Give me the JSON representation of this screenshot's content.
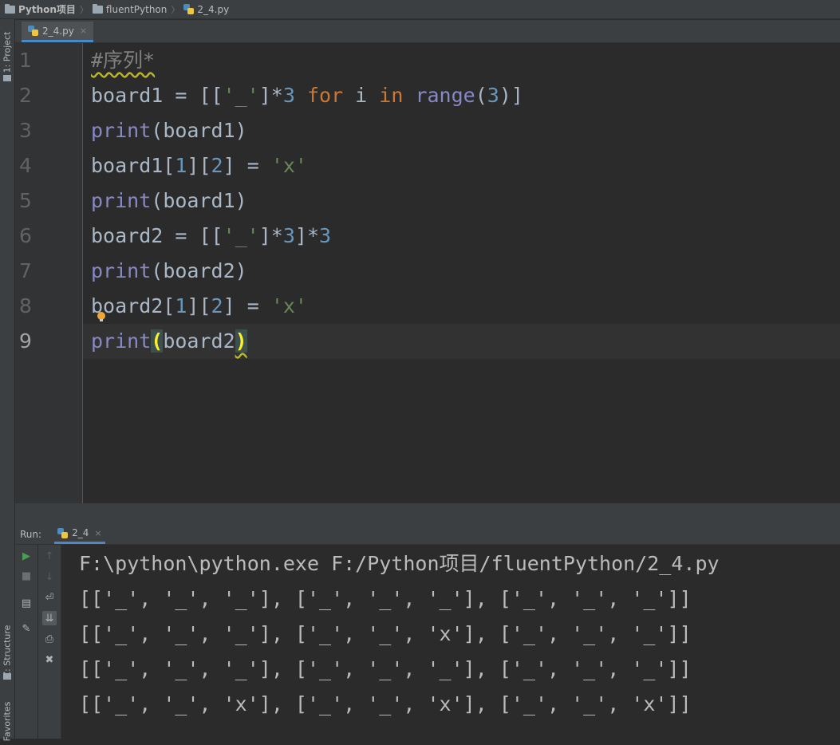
{
  "breadcrumb": {
    "project": "Python项目",
    "folder": "fluentPython",
    "file": "2_4.py"
  },
  "left_strip": {
    "project_tab": "1: Project",
    "structure_tab": "Z: Structure",
    "favorites_tab": "Favorites"
  },
  "editor_tab": {
    "label": "2_4.py",
    "close": "×"
  },
  "line_numbers": [
    "1",
    "2",
    "3",
    "4",
    "5",
    "6",
    "7",
    "8",
    "9"
  ],
  "code": {
    "l1": "#序列*",
    "l2": {
      "a": "board1 = [[",
      "b": "'_'",
      "c": "]*",
      "d": "3",
      "e": " ",
      "f": "for",
      "g": " i ",
      "h": "in",
      "i": " ",
      "j": "range",
      "k": "(",
      "l": "3",
      "m": ")]"
    },
    "l3": {
      "a": "print",
      "b": "(board1)"
    },
    "l4": {
      "a": "board1[",
      "b": "1",
      "c": "][",
      "d": "2",
      "e": "] = ",
      "f": "'x'"
    },
    "l5": {
      "a": "print",
      "b": "(board1)"
    },
    "l6": {
      "a": "board2 = [[",
      "b": "'_'",
      "c": "]*",
      "d": "3",
      "e": "]*",
      "f": "3"
    },
    "l7": {
      "a": "print",
      "b": "(board2)"
    },
    "l8": {
      "a": "board2[",
      "b": "1",
      "c": "][",
      "d": "2",
      "e": "] = ",
      "f": "'x'"
    },
    "l9": {
      "a": "print",
      "b": "(",
      "c": "board2",
      "d": ")"
    }
  },
  "run_panel": {
    "label": "Run:",
    "tab_label": "2_4",
    "tab_close": "×",
    "output": [
      "F:\\python\\python.exe F:/Python项目/fluentPython/2_4.py",
      "[['_', '_', '_'], ['_', '_', '_'], ['_', '_', '_']]",
      "[['_', '_', '_'], ['_', '_', 'x'], ['_', '_', '_']]",
      "[['_', '_', '_'], ['_', '_', '_'], ['_', '_', '_']]",
      "[['_', '_', 'x'], ['_', '_', 'x'], ['_', '_', 'x']]"
    ]
  },
  "colors": {
    "keyword": "#cc7832",
    "builtin": "#8888c6",
    "number": "#6897bb",
    "string": "#6a8759",
    "comment": "#808080",
    "run_green": "#499c54"
  }
}
